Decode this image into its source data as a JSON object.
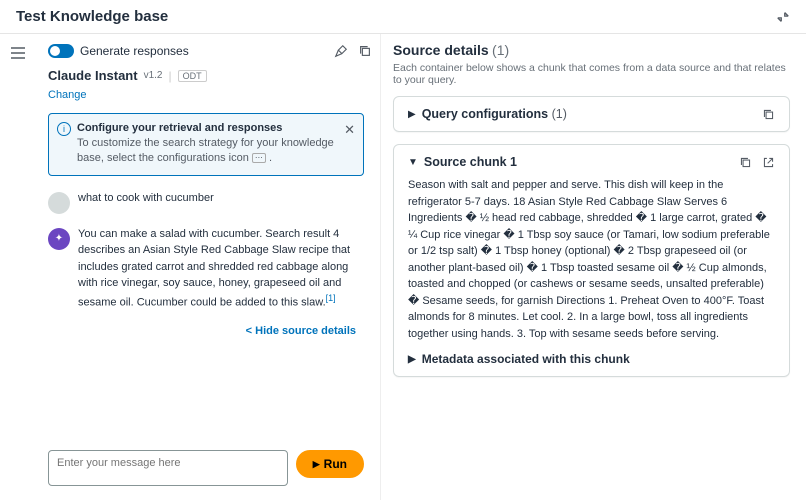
{
  "header": {
    "title": "Test Knowledge base"
  },
  "left": {
    "generate_label": "Generate responses",
    "model_name": "Claude Instant",
    "model_version": "v1.2",
    "model_tag": "ODT",
    "change_link": "Change",
    "info": {
      "title": "Configure your retrieval and responses",
      "text_a": "To customize the search strategy for your knowledge base, select the configurations icon ",
      "text_b": " ."
    },
    "user_message": "what to cook with cucumber",
    "bot_message": "You can make a salad with cucumber. Search result 4 describes an Asian Style Red Cabbage Slaw recipe that includes grated carrot and shredded red cabbage along with rice vinegar, soy sauce, honey, grapeseed oil and sesame oil. Cucumber could be added to this slaw.",
    "citation": "[1]",
    "hide_link": "< Hide source details",
    "composer_placeholder": "Enter your message here",
    "run_label": "Run"
  },
  "right": {
    "title": "Source details",
    "count": "(1)",
    "subtitle": "Each container below shows a chunk that comes from a data source and that relates to your query.",
    "query_conf_title": "Query configurations",
    "query_conf_count": "(1)",
    "chunk_title": "Source chunk 1",
    "chunk_body": "Season with salt and pepper and serve. This dish will keep in the refrigerator 5-7 days. 18 Asian Style Red Cabbage Slaw Serves 6 Ingredients � ½ head red cabbage, shredded � 1 large carrot, grated � ¼ Cup rice vinegar � 1 Tbsp soy sauce (or Tamari, low sodium preferable or 1/2 tsp salt) � 1 Tbsp honey (optional) � 2 Tbsp grapeseed oil (or another plant-based oil) � 1 Tbsp toasted sesame oil � ½ Cup almonds, toasted and chopped (or cashews or sesame seeds, unsalted preferable) � Sesame seeds, for garnish Directions 1. Preheat Oven to 400°F. Toast almonds for 8 minutes. Let cool. 2. In a large bowl, toss all ingredients together using hands. 3. Top with sesame seeds before serving.",
    "metadata_title": "Metadata associated with this chunk"
  }
}
